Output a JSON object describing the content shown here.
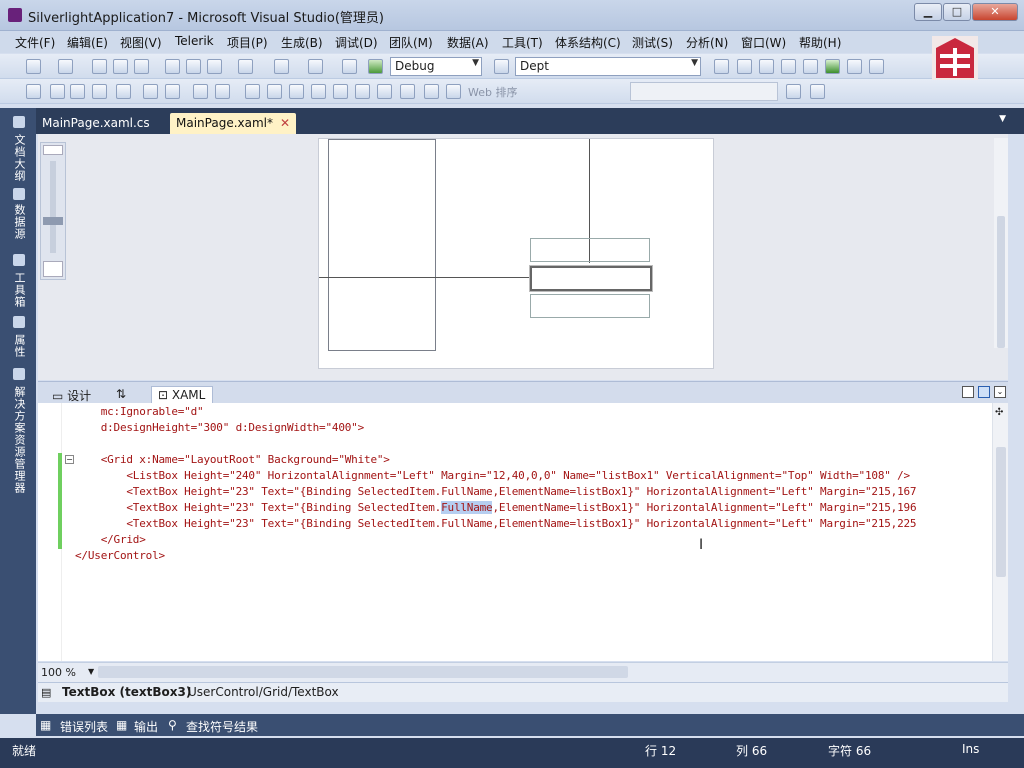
{
  "window": {
    "title": "SilverlightApplication7 - Microsoft Visual Studio(管理员)"
  },
  "menu": [
    "文件(F)",
    "编辑(E)",
    "视图(V)",
    "Telerik",
    "项目(P)",
    "生成(B)",
    "调试(D)",
    "团队(M)",
    "数据(A)",
    "工具(T)",
    "体系结构(C)",
    "测试(S)",
    "分析(N)",
    "窗口(W)",
    "帮助(H)"
  ],
  "toolbar": {
    "config": "Debug",
    "find": "Dept",
    "web_label": "Web 排序",
    "icons": [
      "new-project-icon",
      "add-item-icon",
      "open-file-icon",
      "save-icon",
      "save-all-icon",
      "cut-icon",
      "copy-icon",
      "paste-icon",
      "undo-icon",
      "redo-icon",
      "navigate-icon",
      "find-icon",
      "start-debug-icon"
    ]
  },
  "left_strip": {
    "tabs": [
      "文档大纲",
      "数据源",
      "工具箱",
      "属性",
      "解决方案资源管理器"
    ]
  },
  "doc_tabs": [
    {
      "label": "MainPage.xaml.cs",
      "active": false
    },
    {
      "label": "MainPage.xaml*",
      "active": true
    }
  ],
  "view_tabs": {
    "design": "设计",
    "swap": "⇅",
    "xaml": "XAML"
  },
  "code_lines": [
    {
      "text": "    mc:Ignorable=\"d\""
    },
    {
      "text": "    d:DesignHeight=\"300\" d:DesignWidth=\"400\">"
    },
    {
      "text": ""
    },
    {
      "text": "    <Grid x:Name=\"LayoutRoot\" Background=\"White\">"
    },
    {
      "text": "        <ListBox Height=\"240\" HorizontalAlignment=\"Left\" Margin=\"12,40,0,0\" Name=\"listBox1\" VerticalAlignment=\"Top\" Width=\"108\" />"
    },
    {
      "text": "        <TextBox Height=\"23\" Text=\"{Binding SelectedItem.FullName,ElementName=listBox1}\" HorizontalAlignment=\"Left\" Margin=\"215,167"
    },
    {
      "pre": "        <TextBox Height=\"23\" Text=\"{Binding SelectedItem.",
      "hl": "FullName",
      "post": ",ElementName=listBox1}\" HorizontalAlignment=\"Left\" Margin=\"215,196"
    },
    {
      "text": "        <TextBox Height=\"23\" Text=\"{Binding SelectedItem.FullName,ElementName=listBox1}\" HorizontalAlignment=\"Left\" Margin=\"215,225"
    },
    {
      "text": "    </Grid>"
    },
    {
      "text": "</UserControl>"
    }
  ],
  "zoom": "100 %",
  "breadcrumb": {
    "element": "TextBox (textBox3)",
    "path": "UserControl/Grid/TextBox"
  },
  "bottom_tabs": [
    "错误列表",
    "输出",
    "查找符号结果"
  ],
  "status": {
    "ready": "就绪",
    "line": "行 12",
    "col": "列 66",
    "char": "字符 66",
    "mode": "Ins"
  },
  "colors": {
    "accent": "#2c3d5a",
    "status_bar": "#2a3a58"
  }
}
